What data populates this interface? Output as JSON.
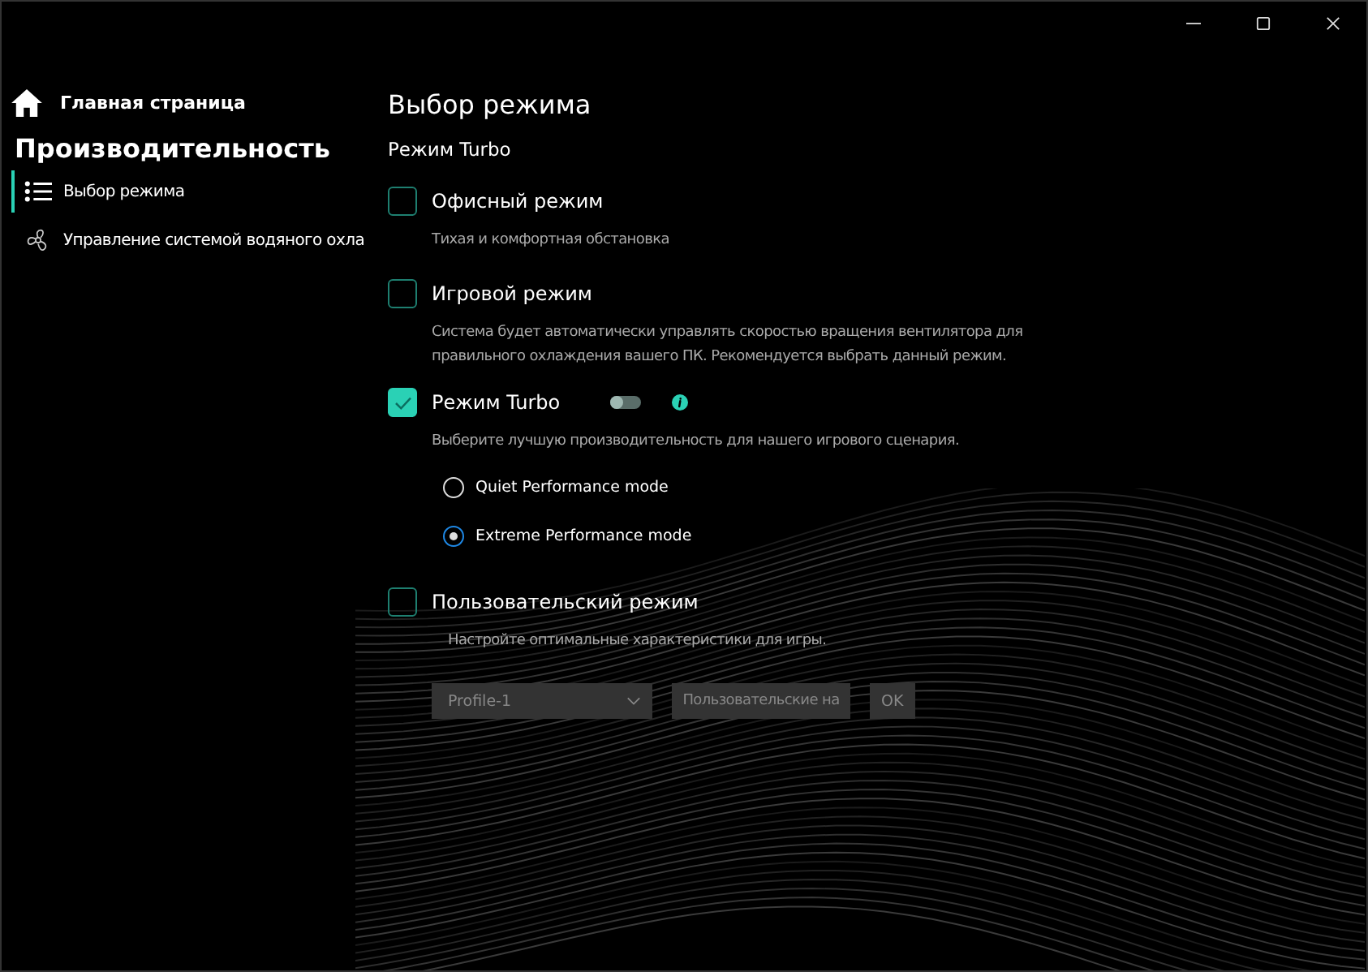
{
  "sidebar": {
    "home": "Главная страница",
    "section": "Производительность",
    "items": [
      {
        "label": "Выбор режима",
        "kind": "list",
        "selected": true
      },
      {
        "label": "Управление системой водяного охла",
        "kind": "fan",
        "selected": false
      }
    ]
  },
  "page": {
    "title": "Выбор режима",
    "current": "Режим Turbo"
  },
  "modes": [
    {
      "kind": "plain",
      "title": "Офисный режим",
      "checked": false,
      "description": "Тихая и комфортная обстановка"
    },
    {
      "kind": "plain",
      "title": "Игровой режим",
      "checked": false,
      "description": "Система будет автоматически управлять скоростью вращения вентилятора для правильного охлаждения вашего ПК. Рекомендуется выбрать данный режим."
    },
    {
      "kind": "turbo",
      "title": "Режим Turbo",
      "checked": true,
      "toggle_on": false,
      "description": "Выберите лучшую производительность для нашего игрового сценария.",
      "options": [
        {
          "label": "Quiet Performance mode",
          "selected": false
        },
        {
          "label": "Extreme Performance mode",
          "selected": true
        }
      ]
    },
    {
      "kind": "custom",
      "title": "Пользовательский режим",
      "checked": false,
      "description": "Настройте оптимальные характеристики для игры.",
      "disabled": true,
      "profile": "Profile-1",
      "custom_button": "Пользовательские на",
      "ok_button": "OK"
    }
  ]
}
